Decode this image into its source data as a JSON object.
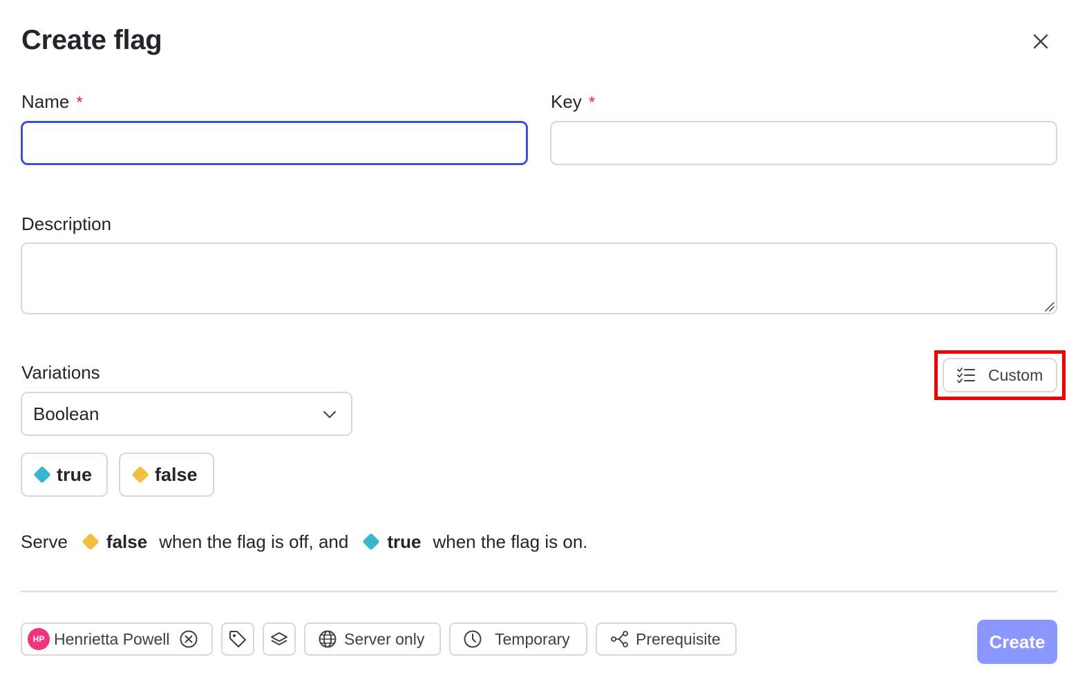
{
  "dialog": {
    "title": "Create flag"
  },
  "name_field": {
    "label": "Name",
    "required_mark": "*",
    "value": "",
    "placeholder": ""
  },
  "key_field": {
    "label": "Key",
    "required_mark": "*",
    "value": "",
    "placeholder": ""
  },
  "description_field": {
    "label": "Description",
    "value": ""
  },
  "variations": {
    "label": "Variations",
    "custom_button_label": "Custom",
    "type_selected": "Boolean",
    "values": [
      {
        "label": "true",
        "color": "#38b6d0"
      },
      {
        "label": "false",
        "color": "#f0c040"
      }
    ],
    "serve_sentence": {
      "prefix": "Serve",
      "off_value": "false",
      "off_text": "when the flag is off, and",
      "on_value": "true",
      "on_text": "when the flag is on."
    }
  },
  "footer": {
    "maintainer": {
      "initials": "HP",
      "name": "Henrietta Powell"
    },
    "server_only_label": "Server only",
    "temporary_label": "Temporary",
    "prerequisite_label": "Prerequisite",
    "create_label": "Create"
  },
  "colors": {
    "focus_border": "#3b4fd8",
    "required": "#e0245e",
    "create_button": "#8a97ff",
    "avatar": "#f0357e",
    "highlight": "#f00000"
  }
}
